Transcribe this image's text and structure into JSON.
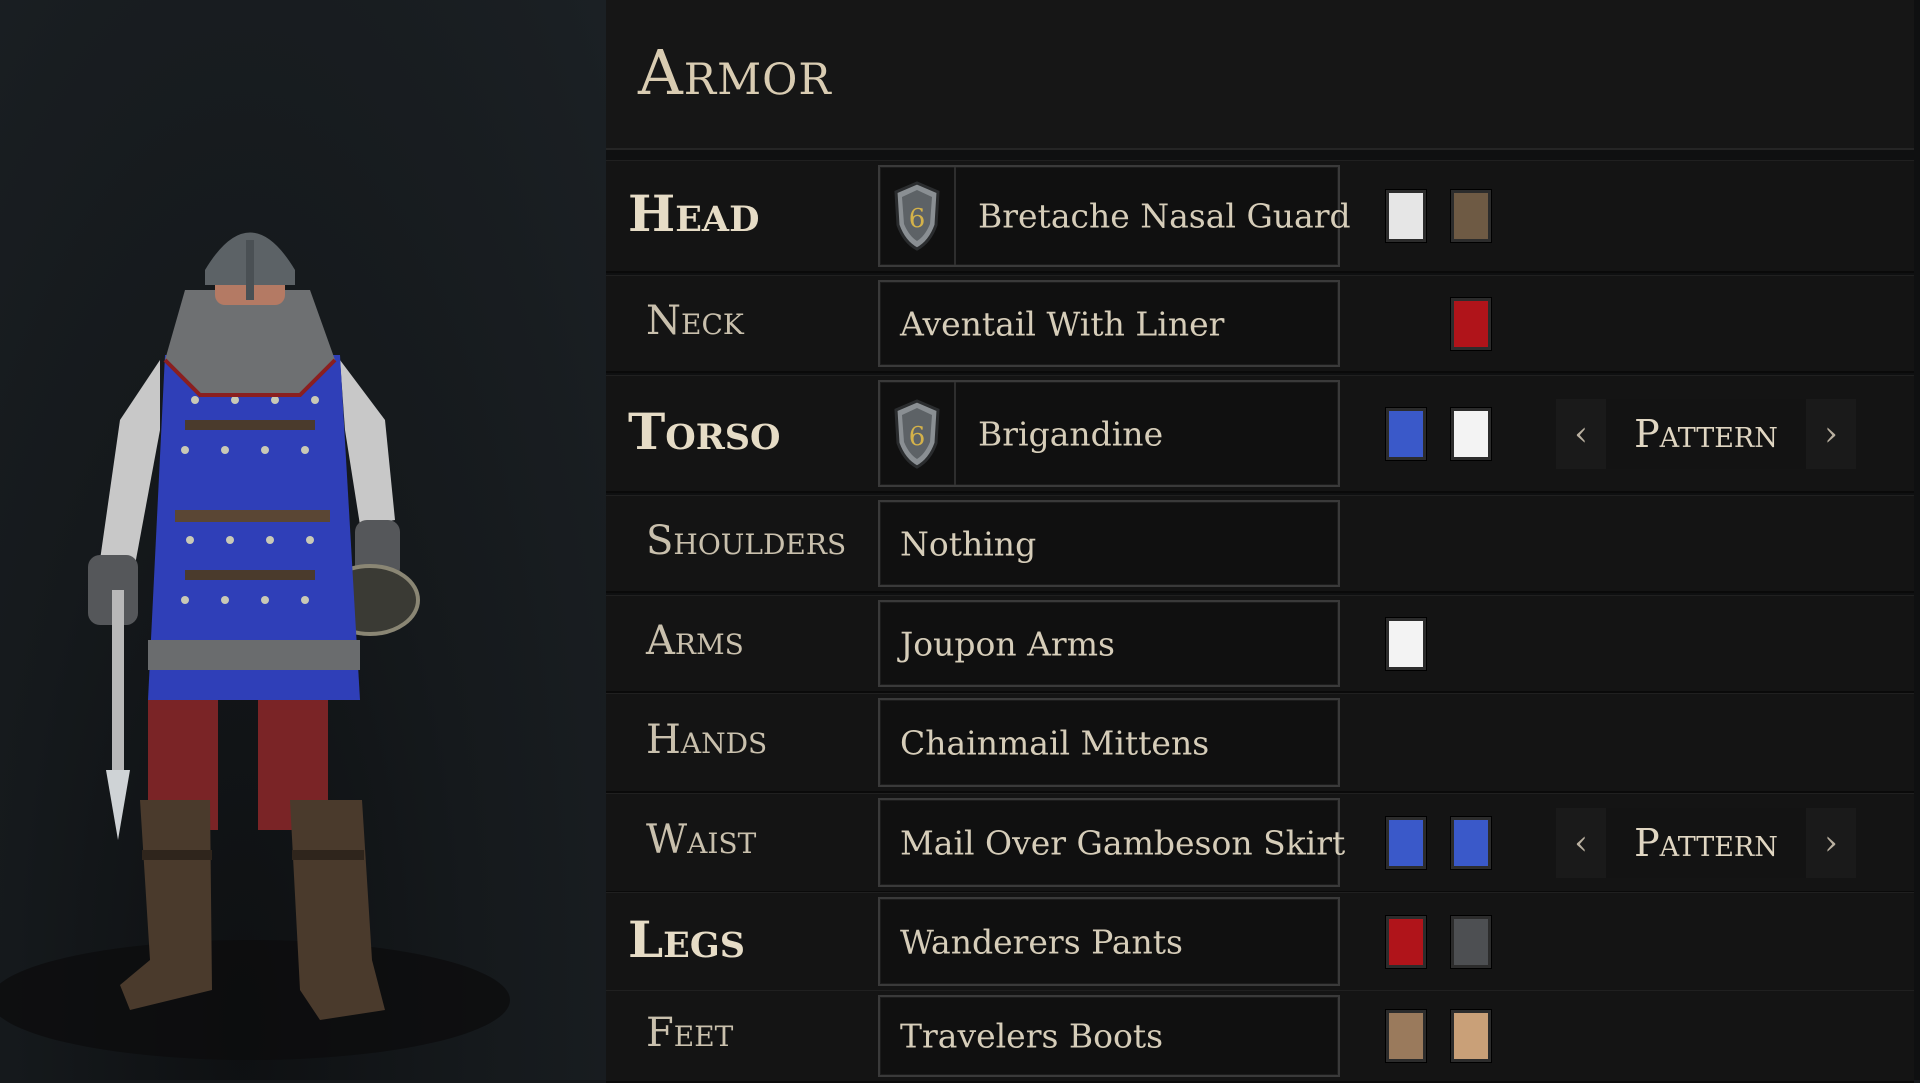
{
  "panel": {
    "title": "Armor"
  },
  "slots": [
    {
      "label": "Head",
      "item": "Bretache Nasal Guard",
      "tier": "6",
      "colors": [
        "#e6e6e6",
        "#6e5a44"
      ],
      "pattern": null
    },
    {
      "label": "Neck",
      "item": "Aventail With Liner",
      "tier": null,
      "colors": [
        "#b0141a"
      ],
      "pattern": null
    },
    {
      "label": "Torso",
      "item": "Brigandine",
      "tier": "6",
      "colors": [
        "#3a59c9",
        "#f3f3f3"
      ],
      "pattern": "Pattern"
    },
    {
      "label": "Shoulders",
      "item": "Nothing",
      "tier": null,
      "colors": [],
      "pattern": null
    },
    {
      "label": "Arms",
      "item": "Joupon Arms",
      "tier": null,
      "colors": [
        "#f3f3f3"
      ],
      "pattern": null
    },
    {
      "label": "Hands",
      "item": "Chainmail Mittens",
      "tier": null,
      "colors": [],
      "pattern": null
    },
    {
      "label": "Waist",
      "item": "Mail Over Gambeson Skirt",
      "tier": null,
      "colors": [
        "#3a59c9",
        "#3a59c9"
      ],
      "pattern": "Pattern"
    },
    {
      "label": "Legs",
      "item": "Wanderers Pants",
      "tier": null,
      "colors": [
        "#b0141a",
        "#4d4f52"
      ],
      "pattern": null
    },
    {
      "label": "Feet",
      "item": "Travelers Boots",
      "tier": null,
      "colors": [
        "#9a7a5c",
        "#c9a078"
      ],
      "pattern": null
    }
  ],
  "pattern_arrows": {
    "prev": "‹",
    "next": "›"
  }
}
